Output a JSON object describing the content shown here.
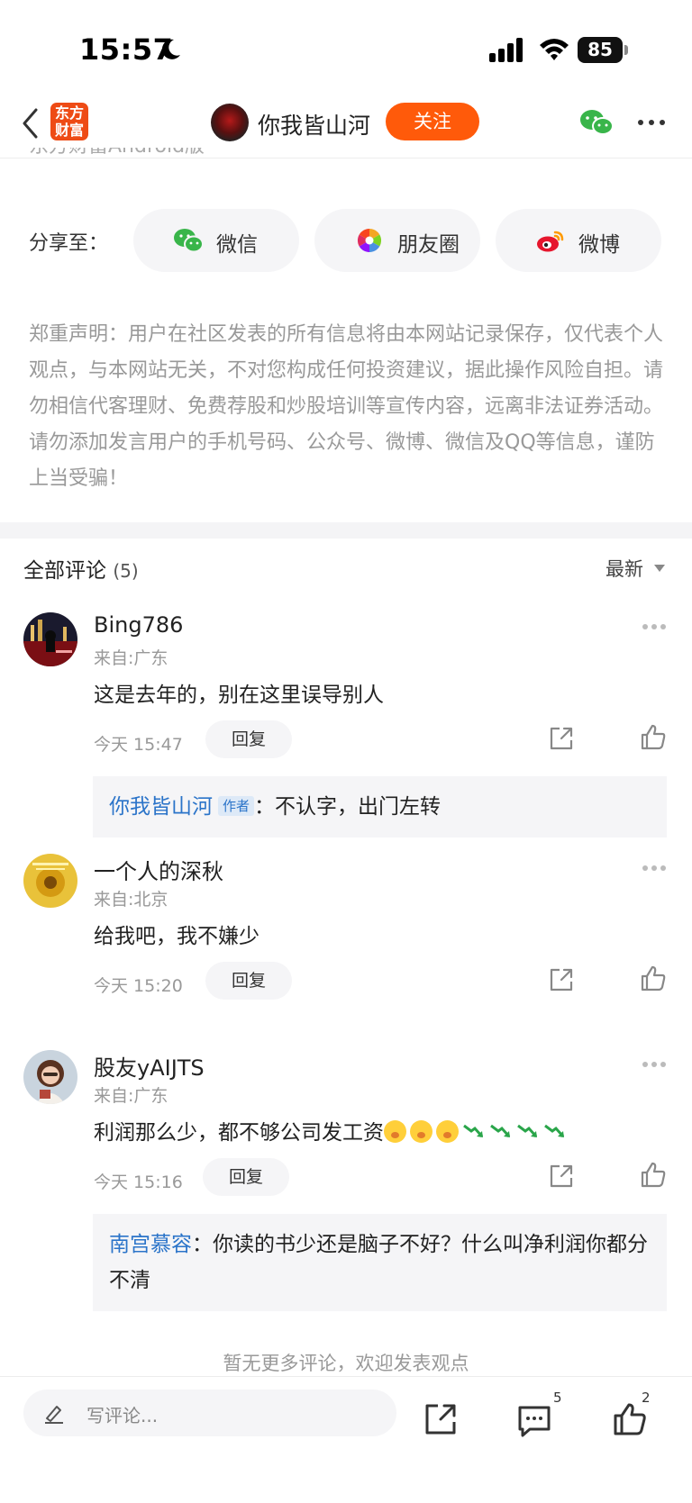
{
  "status_bar": {
    "time": "15:57",
    "battery": "85"
  },
  "nav": {
    "logo_line1": "东方",
    "logo_line2": "财富",
    "author_name": "你我皆山河",
    "follow_label": "关注"
  },
  "partial_text": "东方财富Android版",
  "share": {
    "label": "分享至：",
    "options": [
      {
        "label": "微信",
        "icon": "wechat-icon"
      },
      {
        "label": "朋友圈",
        "icon": "moments-icon"
      },
      {
        "label": "微博",
        "icon": "weibo-icon"
      }
    ]
  },
  "disclaimer": "郑重声明：用户在社区发表的所有信息将由本网站记录保存，仅代表个人观点，与本网站无关，不对您构成任何投资建议，据此操作风险自担。请勿相信代客理财、免费荐股和炒股培训等宣传内容，远离非法证券活动。请勿添加发言用户的手机号码、公众号、微博、微信及QQ等信息，谨防上当受骗！",
  "comments_section": {
    "title": "全部评论",
    "count": "(5)",
    "sort_label": "最新"
  },
  "comments": [
    {
      "name": "Bing786",
      "location": "来自:广东",
      "text": "这是去年的，别在这里误导别人",
      "time": "今天 15:47",
      "reply_label": "回复",
      "reply": {
        "name": "你我皆山河",
        "badge": "作者",
        "sep": "：",
        "text": "不认字，出门左转"
      }
    },
    {
      "name": "一个人的深秋",
      "location": "来自:北京",
      "text": "给我吧，我不嫌少",
      "time": "今天 15:20",
      "reply_label": "回复"
    },
    {
      "name": "股友yAIJTS",
      "location": "来自:广东",
      "text": "利润那么少，都不够公司发工资",
      "time": "今天 15:16",
      "reply_label": "回复",
      "reply": {
        "name": "南宫慕容",
        "sep": "：",
        "text": "你读的书少还是脑子不好？什么叫净利润你都分不清"
      }
    }
  ],
  "no_more_text": "暂无更多评论，欢迎发表观点",
  "bottom_bar": {
    "input_placeholder": "写评论...",
    "comment_count": "5",
    "like_count": "2"
  },
  "colors": {
    "accent": "#ff5a0a",
    "brand": "#ee4b15",
    "link": "#2b74c9"
  }
}
